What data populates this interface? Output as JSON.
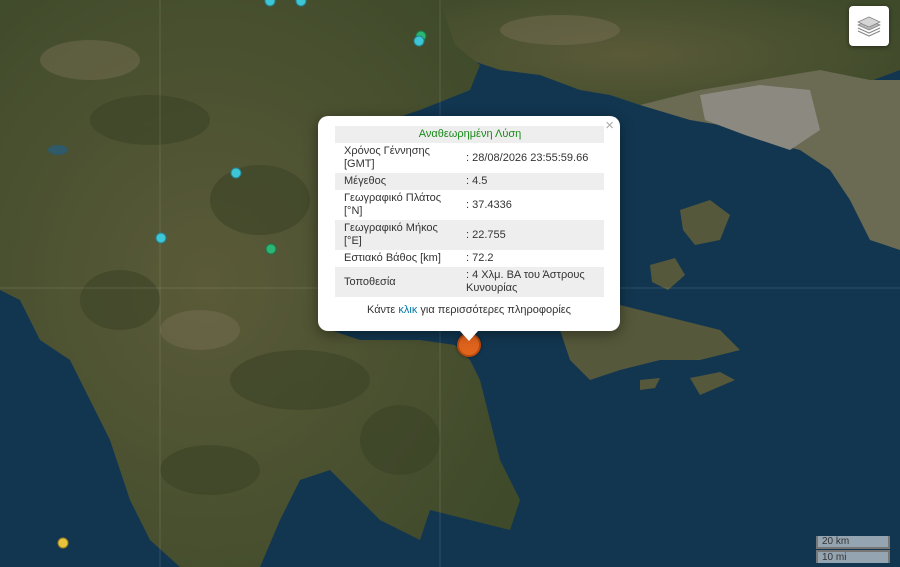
{
  "map": {
    "colors": {
      "sea": "#123650",
      "land": "#4d5230",
      "urban": "#8c8a80"
    },
    "layers_icon": "layers-icon"
  },
  "popup": {
    "title": "Αναθεωρημένη Λύση",
    "close_label": "×",
    "rows": [
      {
        "label": "Χρόνος Γέννησης [GMT]",
        "value": ": 28/08/2026 23:55:59.66"
      },
      {
        "label": "Μέγεθος",
        "value": ": 4.5"
      },
      {
        "label": "Γεωγραφικό Πλάτος [°N]",
        "value": ": 37.4336"
      },
      {
        "label": "Γεωγραφικό Μήκος [°E]",
        "value": ": 22.755"
      },
      {
        "label": "Εστιακό Βάθος [km]",
        "value": ": 72.2"
      },
      {
        "label": "Τοποθεσία",
        "value": ": 4 Χλμ. ΒΑ του Άστρους Κυνουρίας"
      }
    ],
    "footer_prefix": "Κάντε ",
    "footer_link": "κλικ",
    "footer_suffix": " για περισσότερες πληροφορίες"
  },
  "scale": {
    "km": "20 km",
    "mi": "10 mi"
  }
}
